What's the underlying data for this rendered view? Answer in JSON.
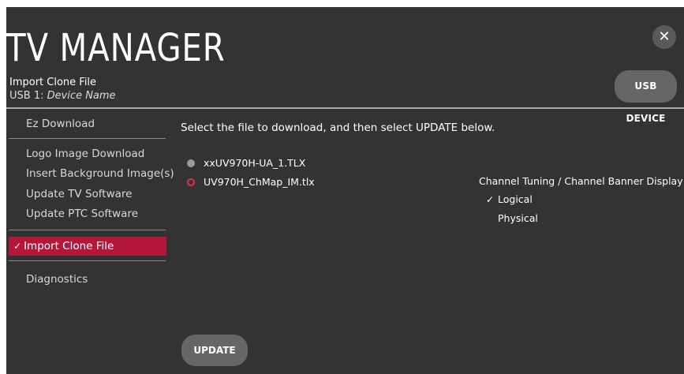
{
  "header": {
    "title": "TV MANAGER",
    "close_label": "✕",
    "subtitle": "Import Clone File",
    "device_prefix": "USB 1: ",
    "device_name": "Device Name",
    "usb_button": "USB DEVICE"
  },
  "sidebar": {
    "items": [
      {
        "label": "Ez Download"
      },
      {
        "label": "Logo Image Download"
      },
      {
        "label": "Insert Background Image(s)"
      },
      {
        "label": "Update TV Software"
      },
      {
        "label": "Update PTC Software"
      },
      {
        "label": "Import Clone File",
        "selected": true
      },
      {
        "label": "Diagnostics"
      }
    ],
    "selected_check": "✓"
  },
  "main": {
    "instruction": "Select the file to download, and then select UPDATE below.",
    "files": [
      {
        "name": "xxUV970H-UA_1.TLX",
        "selected": false
      },
      {
        "name": "UV970H_ChMap_IM.tlx",
        "selected": true
      }
    ],
    "tuning": {
      "title": "Channel Tuning / Channel Banner Display",
      "options": [
        {
          "label": "Logical",
          "checked": true
        },
        {
          "label": "Physical",
          "checked": false
        }
      ],
      "check_mark": "✓"
    },
    "update_button": "UPDATE"
  },
  "colors": {
    "background": "#333333",
    "accent": "#b3173a",
    "radio_selected": "#e03050",
    "button": "#666666"
  }
}
